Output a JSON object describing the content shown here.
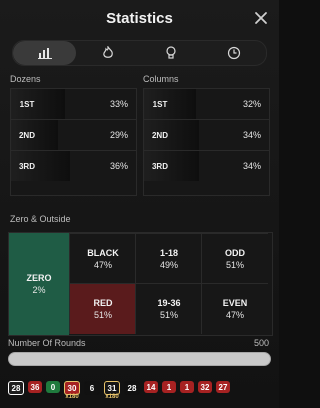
{
  "title": "Statistics",
  "tabs": [
    {
      "icon": "bar-chart-icon",
      "active": true
    },
    {
      "icon": "fire-icon",
      "active": false
    },
    {
      "icon": "lightbulb-icon",
      "active": false
    },
    {
      "icon": "clock-icon",
      "active": false
    }
  ],
  "dozens": {
    "label": "Dozens",
    "rows": [
      {
        "name": "1ST",
        "value": "33%",
        "pct": 33
      },
      {
        "name": "2ND",
        "value": "29%",
        "pct": 29
      },
      {
        "name": "3RD",
        "value": "36%",
        "pct": 36
      }
    ]
  },
  "columns": {
    "label": "Columns",
    "rows": [
      {
        "name": "1ST",
        "value": "32%",
        "pct": 32
      },
      {
        "name": "2ND",
        "value": "34%",
        "pct": 34
      },
      {
        "name": "3RD",
        "value": "34%",
        "pct": 34
      }
    ]
  },
  "zero_outside": {
    "label": "Zero & Outside",
    "zero": {
      "label": "ZERO",
      "value": "2%"
    },
    "cells": [
      {
        "label": "BLACK",
        "value": "47%",
        "bg": "#171717"
      },
      {
        "label": "1-18",
        "value": "49%",
        "bg": "#171717"
      },
      {
        "label": "ODD",
        "value": "51%",
        "bg": "#171717"
      },
      {
        "label": "RED",
        "value": "51%",
        "bg": "#5a1b1c"
      },
      {
        "label": "19-36",
        "value": "51%",
        "bg": "#171717"
      },
      {
        "label": "EVEN",
        "value": "47%",
        "bg": "#171717"
      }
    ]
  },
  "rounds": {
    "label": "Number Of Rounds",
    "max": "500",
    "fill_fraction": 1
  },
  "history": [
    {
      "num": "28",
      "type": "black"
    },
    {
      "num": "36",
      "type": "red"
    },
    {
      "num": "0",
      "type": "green"
    },
    {
      "num": "30",
      "type": "gold",
      "mult": "x180"
    },
    {
      "num": "6",
      "type": "dark"
    },
    {
      "num": "31",
      "type": "gold",
      "mult": "x180"
    },
    {
      "num": "28",
      "type": "dark"
    },
    {
      "num": "14",
      "type": "red"
    },
    {
      "num": "1",
      "type": "red"
    },
    {
      "num": "1",
      "type": "red"
    },
    {
      "num": "32",
      "type": "red"
    },
    {
      "num": "27",
      "type": "red"
    }
  ],
  "colors": {
    "zero": "#1f5c45",
    "red": "#5a1b1c",
    "chip_red": "#a62222",
    "chip_green": "#1f7a3d",
    "gold": "#e6c36b"
  }
}
